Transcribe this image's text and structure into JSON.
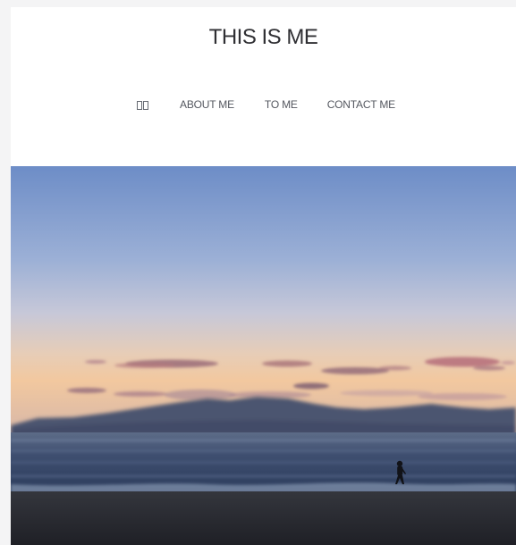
{
  "site": {
    "title": "THIS IS ME"
  },
  "nav": {
    "items": [
      {
        "label": "",
        "icon": "home-glyph-icon"
      },
      {
        "label": "ABOUT ME"
      },
      {
        "label": "TO ME"
      },
      {
        "label": "CONTACT ME"
      }
    ]
  },
  "hero": {
    "image": "seaside-sunset-photo",
    "colors": {
      "sky_top": "#6f8fc8",
      "sky_mid": "#aab8d3",
      "horizon_glow": "#f0c8a0",
      "mountains": "#4b5068",
      "sea": "#3c4c6a",
      "beach": "#2a2c33"
    }
  }
}
